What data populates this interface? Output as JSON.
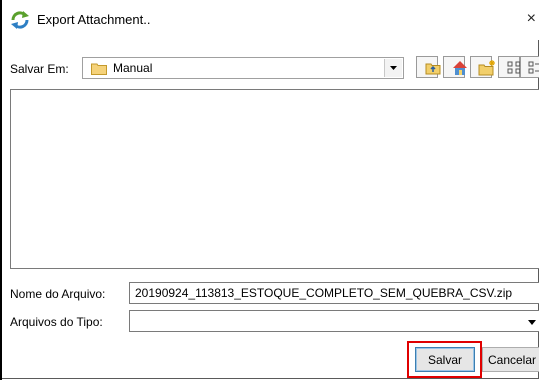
{
  "window": {
    "title": "Export Attachment..",
    "close_glyph": "×"
  },
  "lookin": {
    "label": "Salvar Em:",
    "value": "Manual"
  },
  "form": {
    "filename_label": "Nome do Arquivo:",
    "filename_value": "20190924_113813_ESTOQUE_COMPLETO_SEM_QUEBRA_CSV.zip",
    "filetype_label": "Arquivos do Tipo:",
    "filetype_value": ""
  },
  "buttons": {
    "save": "Salvar",
    "cancel": "Cancelar"
  },
  "icons": {
    "app": "export-arrows-icon",
    "folder": "folder-icon",
    "up": "up-one-level-icon",
    "home": "home-icon",
    "new_folder": "new-folder-icon",
    "list": "list-view-icon",
    "details": "details-view-icon"
  },
  "colors": {
    "highlight": "#e00000",
    "default_button_border": "#3c7fb1"
  }
}
